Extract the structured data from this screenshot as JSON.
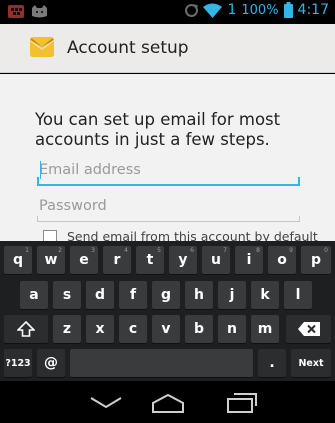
{
  "status_bar": {
    "notification_icons": [
      "bbm-icon",
      "cat-face-icon"
    ],
    "system_icons": [
      "data-sync-icon",
      "wifi-icon"
    ],
    "signal_label": "1",
    "battery_percent": "100%",
    "time": "4:17"
  },
  "action_bar": {
    "title": "Account setup",
    "icon": "mail-envelope-icon"
  },
  "form": {
    "intro": "You can set up email for most accounts in just a few steps.",
    "email_placeholder": "Email address",
    "email_value": "",
    "password_placeholder": "Password",
    "password_value": "",
    "default_checkbox_label": "Send email from this account by default",
    "default_checkbox_checked": false
  },
  "keyboard": {
    "row1": [
      {
        "label": "q",
        "hint": "1"
      },
      {
        "label": "w",
        "hint": "2"
      },
      {
        "label": "e",
        "hint": "3"
      },
      {
        "label": "r",
        "hint": "4"
      },
      {
        "label": "t",
        "hint": "5"
      },
      {
        "label": "y",
        "hint": "6"
      },
      {
        "label": "u",
        "hint": "7"
      },
      {
        "label": "i",
        "hint": "8"
      },
      {
        "label": "o",
        "hint": "9"
      },
      {
        "label": "p",
        "hint": "0"
      }
    ],
    "row2": [
      "a",
      "s",
      "d",
      "f",
      "g",
      "h",
      "j",
      "k",
      "l"
    ],
    "row3": [
      "z",
      "x",
      "c",
      "v",
      "b",
      "n",
      "m"
    ],
    "symbols_key": "?123",
    "at_key": "@",
    "period_key": ".",
    "action_key": "Next",
    "shift_icon": "shift-arrow-icon",
    "delete_icon": "backspace-icon"
  },
  "nav_bar": {
    "buttons": [
      "back-icon",
      "home-icon",
      "recent-apps-icon"
    ]
  }
}
